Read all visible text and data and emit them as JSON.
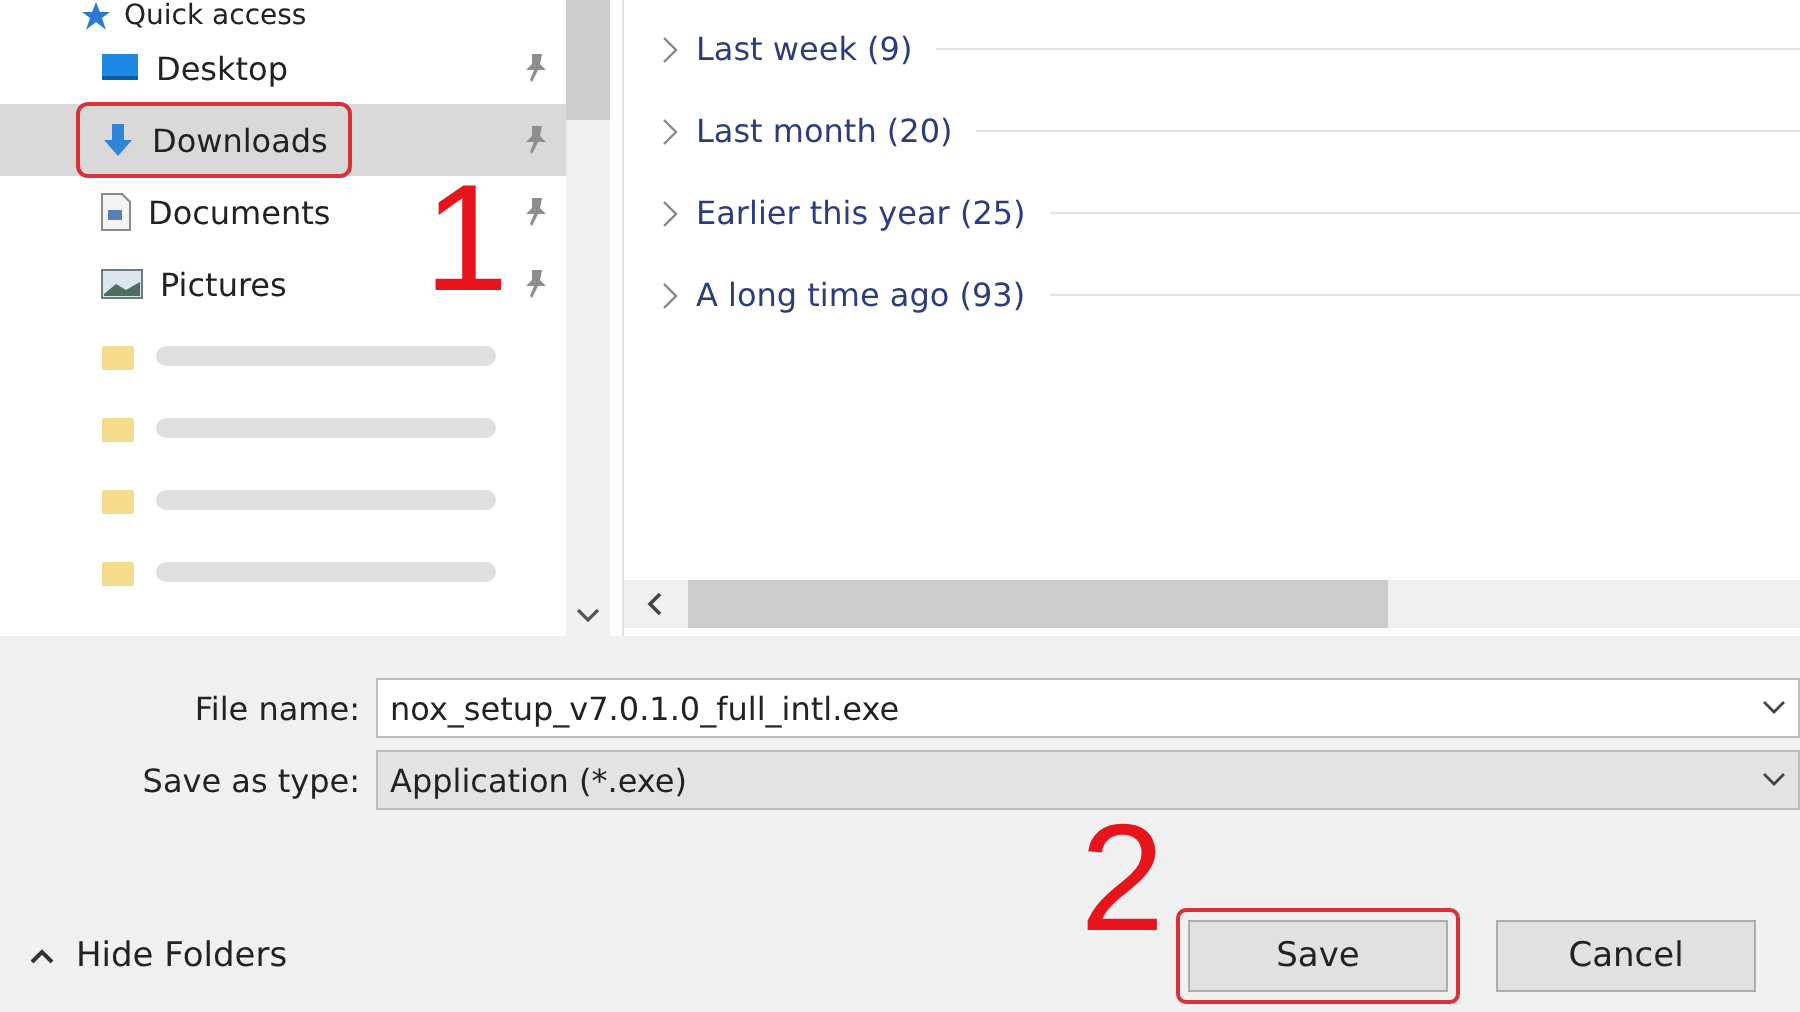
{
  "sidebar": {
    "header": "Quick access",
    "items": [
      {
        "label": "Desktop",
        "kind": "desktop",
        "pinned": true,
        "selected": false,
        "highlighted": false
      },
      {
        "label": "Downloads",
        "kind": "download",
        "pinned": true,
        "selected": true,
        "highlighted": true
      },
      {
        "label": "Documents",
        "kind": "document",
        "pinned": true,
        "selected": false,
        "highlighted": false
      },
      {
        "label": "Pictures",
        "kind": "picture",
        "pinned": true,
        "selected": false,
        "highlighted": false
      },
      {
        "kind": "blurred"
      },
      {
        "kind": "blurred"
      },
      {
        "kind": "blurred"
      },
      {
        "kind": "blurred"
      }
    ]
  },
  "groups": [
    {
      "label": "Last week (9)",
      "expanded": false
    },
    {
      "label": "Last month (20)",
      "expanded": false
    },
    {
      "label": "Earlier this year (25)",
      "expanded": false
    },
    {
      "label": "A long time ago (93)",
      "expanded": false
    }
  ],
  "form": {
    "file_name_label": "File name:",
    "file_name": "nox_setup_v7.0.1.0_full_intl.exe",
    "type_label": "Save as type:",
    "type": "Application (*.exe)"
  },
  "hide_folders": "Hide Folders",
  "buttons": [
    {
      "label": "Save",
      "highlighted": true
    },
    {
      "label": "Cancel",
      "highlighted": false
    }
  ],
  "annotations": [
    {
      "label": "1"
    },
    {
      "label": "2"
    }
  ]
}
